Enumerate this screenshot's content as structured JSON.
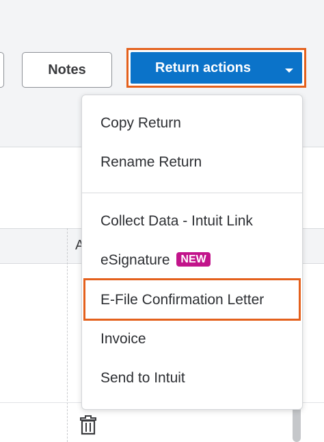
{
  "toolbar": {
    "notes_label": "Notes",
    "return_actions_label": "Return actions"
  },
  "table": {
    "column_header_partial": "A"
  },
  "menu": {
    "items": [
      {
        "label": "Copy Return"
      },
      {
        "label": "Rename Return"
      },
      {
        "label": "Collect Data - Intuit Link"
      },
      {
        "label": "eSignature",
        "badge": "NEW"
      },
      {
        "label": "E-File Confirmation Letter"
      },
      {
        "label": "Invoice"
      },
      {
        "label": "Send to Intuit"
      }
    ]
  },
  "colors": {
    "primary": "#0b73c9",
    "highlight": "#e4601c",
    "badge": "#c2148b"
  }
}
